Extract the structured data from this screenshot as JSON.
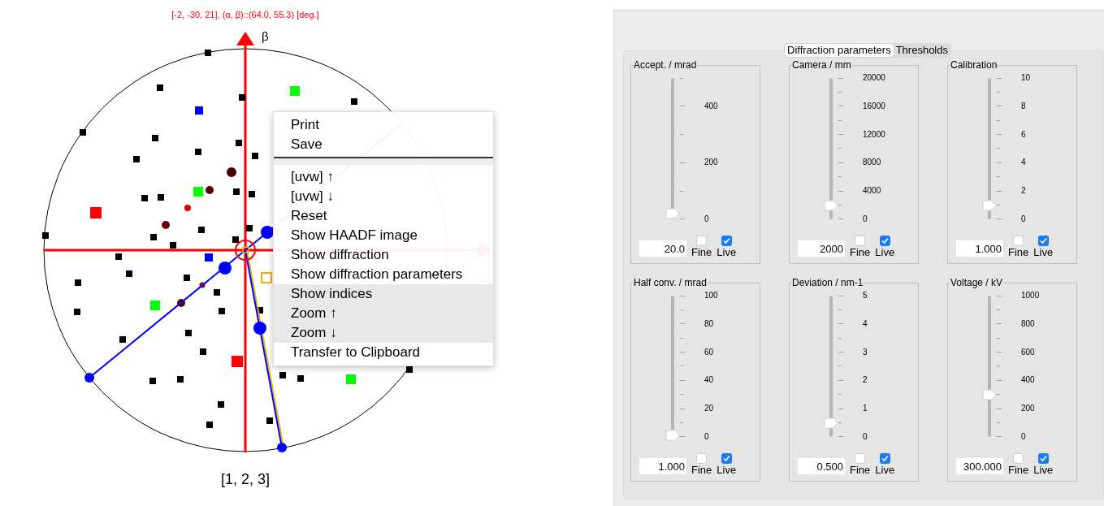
{
  "plot": {
    "title": "[-2, -30, 21], (α, β)::(64.0, 55.3) [deg.]",
    "axis_label": "β",
    "zone_label": "[1, 2, 3]"
  },
  "context_menu": {
    "items": [
      {
        "kind": "item",
        "label": "Print",
        "highlighted": false
      },
      {
        "kind": "item",
        "label": "Save",
        "highlighted": false
      },
      {
        "kind": "separator"
      },
      {
        "kind": "item",
        "label": "[uvw] ↑",
        "highlighted": false
      },
      {
        "kind": "item",
        "label": "[uvw] ↓",
        "highlighted": false
      },
      {
        "kind": "item",
        "label": "Reset",
        "highlighted": false
      },
      {
        "kind": "item",
        "label": "Show HAADF image",
        "highlighted": false
      },
      {
        "kind": "item",
        "label": "Show diffraction",
        "highlighted": false
      },
      {
        "kind": "item",
        "label": "Show diffraction parameters",
        "highlighted": false
      },
      {
        "kind": "item",
        "label": "Show indices",
        "highlighted": true
      },
      {
        "kind": "item",
        "label": "Zoom ↑",
        "highlighted": true
      },
      {
        "kind": "item",
        "label": "Zoom ↓",
        "highlighted": true
      },
      {
        "kind": "item",
        "label": "Transfer to Clipboard",
        "highlighted": false
      }
    ]
  },
  "tabs": [
    {
      "label": "Diffraction parameters",
      "selected": true
    },
    {
      "label": "Thresholds",
      "selected": false
    }
  ],
  "groups": [
    {
      "title": "Accept. / mrad",
      "level": 0.04,
      "value": "20.0",
      "fine": {
        "label": "Fine",
        "checked": false
      },
      "live": {
        "label": "Live",
        "checked": true
      },
      "ticks": [
        {
          "kind": "minor"
        },
        {
          "kind": "major",
          "label": "400"
        },
        {
          "kind": "minor"
        },
        {
          "kind": "major",
          "label": "200"
        },
        {
          "kind": "minor"
        },
        {
          "kind": "major",
          "label": "0"
        }
      ]
    },
    {
      "title": "Camera / mm",
      "level": 0.1,
      "value": "2000",
      "fine": {
        "label": "Fine",
        "checked": false
      },
      "live": {
        "label": "Live",
        "checked": true
      },
      "ticks": [
        {
          "kind": "major",
          "label": "20000"
        },
        {
          "kind": "minor"
        },
        {
          "kind": "major",
          "label": "16000"
        },
        {
          "kind": "minor"
        },
        {
          "kind": "major",
          "label": "12000"
        },
        {
          "kind": "minor"
        },
        {
          "kind": "major",
          "label": "8000"
        },
        {
          "kind": "minor"
        },
        {
          "kind": "major",
          "label": "4000"
        },
        {
          "kind": "minor"
        },
        {
          "kind": "major",
          "label": "0"
        }
      ]
    },
    {
      "title": "Calibration",
      "level": 0.1,
      "value": "1.000",
      "fine": {
        "label": "Fine",
        "checked": false
      },
      "live": {
        "label": "Live",
        "checked": true
      },
      "ticks": [
        {
          "kind": "major",
          "label": "10"
        },
        {
          "kind": "minor"
        },
        {
          "kind": "major",
          "label": "8"
        },
        {
          "kind": "minor"
        },
        {
          "kind": "major",
          "label": "6"
        },
        {
          "kind": "minor"
        },
        {
          "kind": "major",
          "label": "4"
        },
        {
          "kind": "minor"
        },
        {
          "kind": "major",
          "label": "2"
        },
        {
          "kind": "minor"
        },
        {
          "kind": "major",
          "label": "0"
        }
      ]
    },
    {
      "title": "Half conv. / mrad",
      "level": 0.01,
      "value": "1.000",
      "fine": {
        "label": "Fine",
        "checked": false
      },
      "live": {
        "label": "Live",
        "checked": true
      },
      "ticks": [
        {
          "kind": "major",
          "label": "100"
        },
        {
          "kind": "minor"
        },
        {
          "kind": "major",
          "label": "80"
        },
        {
          "kind": "minor"
        },
        {
          "kind": "major",
          "label": "60"
        },
        {
          "kind": "minor"
        },
        {
          "kind": "major",
          "label": "40"
        },
        {
          "kind": "minor"
        },
        {
          "kind": "major",
          "label": "20"
        },
        {
          "kind": "minor"
        },
        {
          "kind": "major",
          "label": "0"
        }
      ]
    },
    {
      "title": "Deviation / nm-1",
      "level": 0.1,
      "value": "0.500",
      "fine": {
        "label": "Fine",
        "checked": false
      },
      "live": {
        "label": "Live",
        "checked": true
      },
      "ticks": [
        {
          "kind": "major",
          "label": "5"
        },
        {
          "kind": "minor"
        },
        {
          "kind": "major",
          "label": "4"
        },
        {
          "kind": "minor"
        },
        {
          "kind": "major",
          "label": "3"
        },
        {
          "kind": "minor"
        },
        {
          "kind": "major",
          "label": "2"
        },
        {
          "kind": "minor"
        },
        {
          "kind": "major",
          "label": "1"
        },
        {
          "kind": "minor"
        },
        {
          "kind": "major",
          "label": "0"
        }
      ]
    },
    {
      "title": "Voltage / kV",
      "level": 0.3,
      "value": "300.000",
      "fine": {
        "label": "Fine",
        "checked": false
      },
      "live": {
        "label": "Live",
        "checked": true
      },
      "ticks": [
        {
          "kind": "major",
          "label": "1000"
        },
        {
          "kind": "minor"
        },
        {
          "kind": "major",
          "label": "800"
        },
        {
          "kind": "minor"
        },
        {
          "kind": "major",
          "label": "600"
        },
        {
          "kind": "minor"
        },
        {
          "kind": "major",
          "label": "400"
        },
        {
          "kind": "minor"
        },
        {
          "kind": "major",
          "label": "200"
        },
        {
          "kind": "minor"
        },
        {
          "kind": "major",
          "label": "0"
        }
      ]
    }
  ]
}
